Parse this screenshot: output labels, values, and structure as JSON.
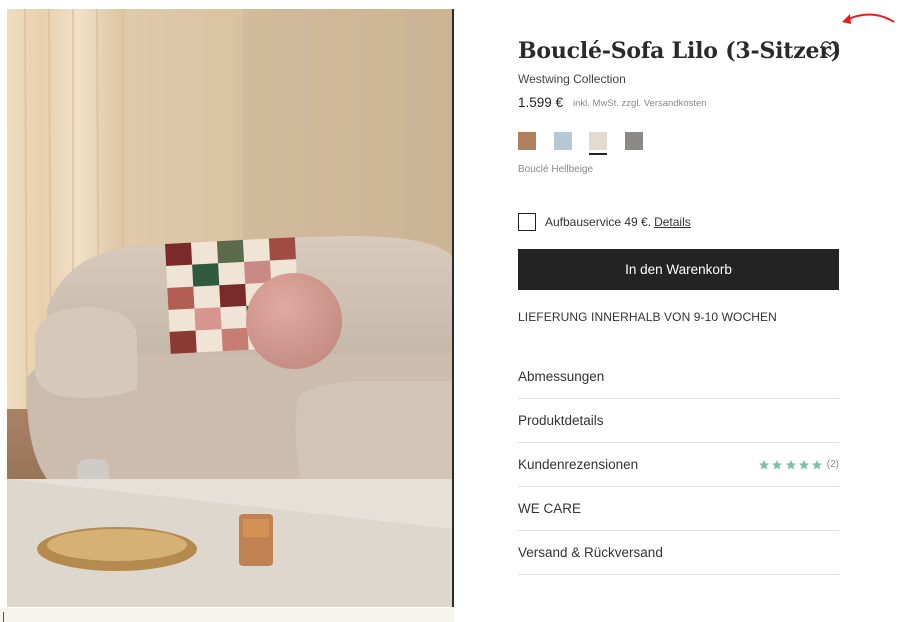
{
  "product": {
    "title": "Bouclé-Sofa Lilo (3-Sitzer)",
    "brand": "Westwing Collection",
    "price": "1.599 €",
    "price_note": "inkl. MwSt. zzgl. Versandkosten",
    "image_description_icon": "sofa-photo"
  },
  "colors": {
    "swatches": [
      {
        "name": "swatch-cognac",
        "color": "#b07f5c",
        "selected": false
      },
      {
        "name": "swatch-light-blue",
        "color": "#b7c9d4",
        "selected": false
      },
      {
        "name": "swatch-hellbeige",
        "color": "#e4dbd0",
        "selected": true
      },
      {
        "name": "swatch-grey",
        "color": "#8b8986",
        "selected": false
      }
    ],
    "selected_label": "Bouclé Hellbeige"
  },
  "service": {
    "label": "Aufbauservice 49 €.",
    "link": "Details",
    "checked": false
  },
  "cart": {
    "button_label": "In den Warenkorb"
  },
  "delivery": {
    "text": "LIEFERUNG INNERHALB VON 9-10 WOCHEN"
  },
  "accordion": {
    "items": [
      {
        "label": "Abmessungen"
      },
      {
        "label": "Produktdetails"
      },
      {
        "label": "Kundenrezensionen",
        "rating": 5,
        "review_count": "(2)"
      },
      {
        "label": "WE CARE"
      },
      {
        "label": "Versand & Rückversand"
      }
    ]
  },
  "icons": {
    "wishlist": "heart-icon",
    "star": "star-icon",
    "annotation": "red-arrow-icon"
  },
  "theme": {
    "star_color": "#7ec2a6",
    "button_bg": "#232323",
    "arrow_color": "#e02020"
  }
}
